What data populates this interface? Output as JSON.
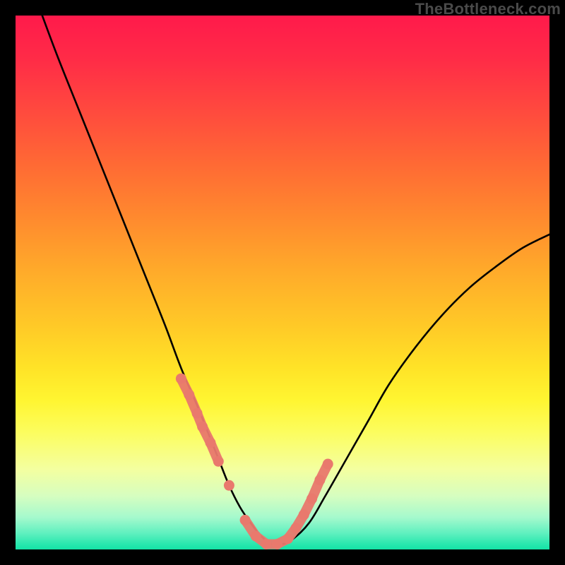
{
  "watermark": "TheBottleneck.com",
  "chart_data": {
    "type": "line",
    "title": "",
    "xlabel": "",
    "ylabel": "",
    "xlim": [
      0,
      100
    ],
    "ylim": [
      0,
      100
    ],
    "grid": false,
    "legend": false,
    "series": [
      {
        "name": "bottleneck-curve",
        "color": "#000000",
        "x": [
          5,
          8,
          12,
          16,
          20,
          24,
          28,
          31,
          34,
          36,
          38,
          40,
          42,
          44,
          46,
          48,
          50,
          52,
          55,
          58,
          62,
          66,
          70,
          75,
          80,
          85,
          90,
          95,
          100
        ],
        "y": [
          100,
          92,
          82,
          72,
          62,
          52,
          42,
          34,
          27,
          22,
          17,
          12,
          8,
          5,
          2.5,
          1,
          1,
          2,
          5,
          10,
          17,
          24,
          31,
          38,
          44,
          49,
          53,
          56.5,
          59
        ]
      }
    ],
    "markers": {
      "name": "highlight-points",
      "style": "rounded-salmon",
      "color": "#e9796d",
      "x": [
        31,
        32.5,
        34,
        35,
        36.5,
        38,
        40,
        43,
        45,
        47,
        49,
        51,
        52.5,
        54,
        55.5,
        57,
        58.5
      ],
      "y": [
        32,
        29,
        25.5,
        23,
        20,
        16.5,
        12,
        5.5,
        2.5,
        1,
        1,
        2,
        4,
        6.5,
        9.5,
        13,
        16
      ]
    }
  }
}
